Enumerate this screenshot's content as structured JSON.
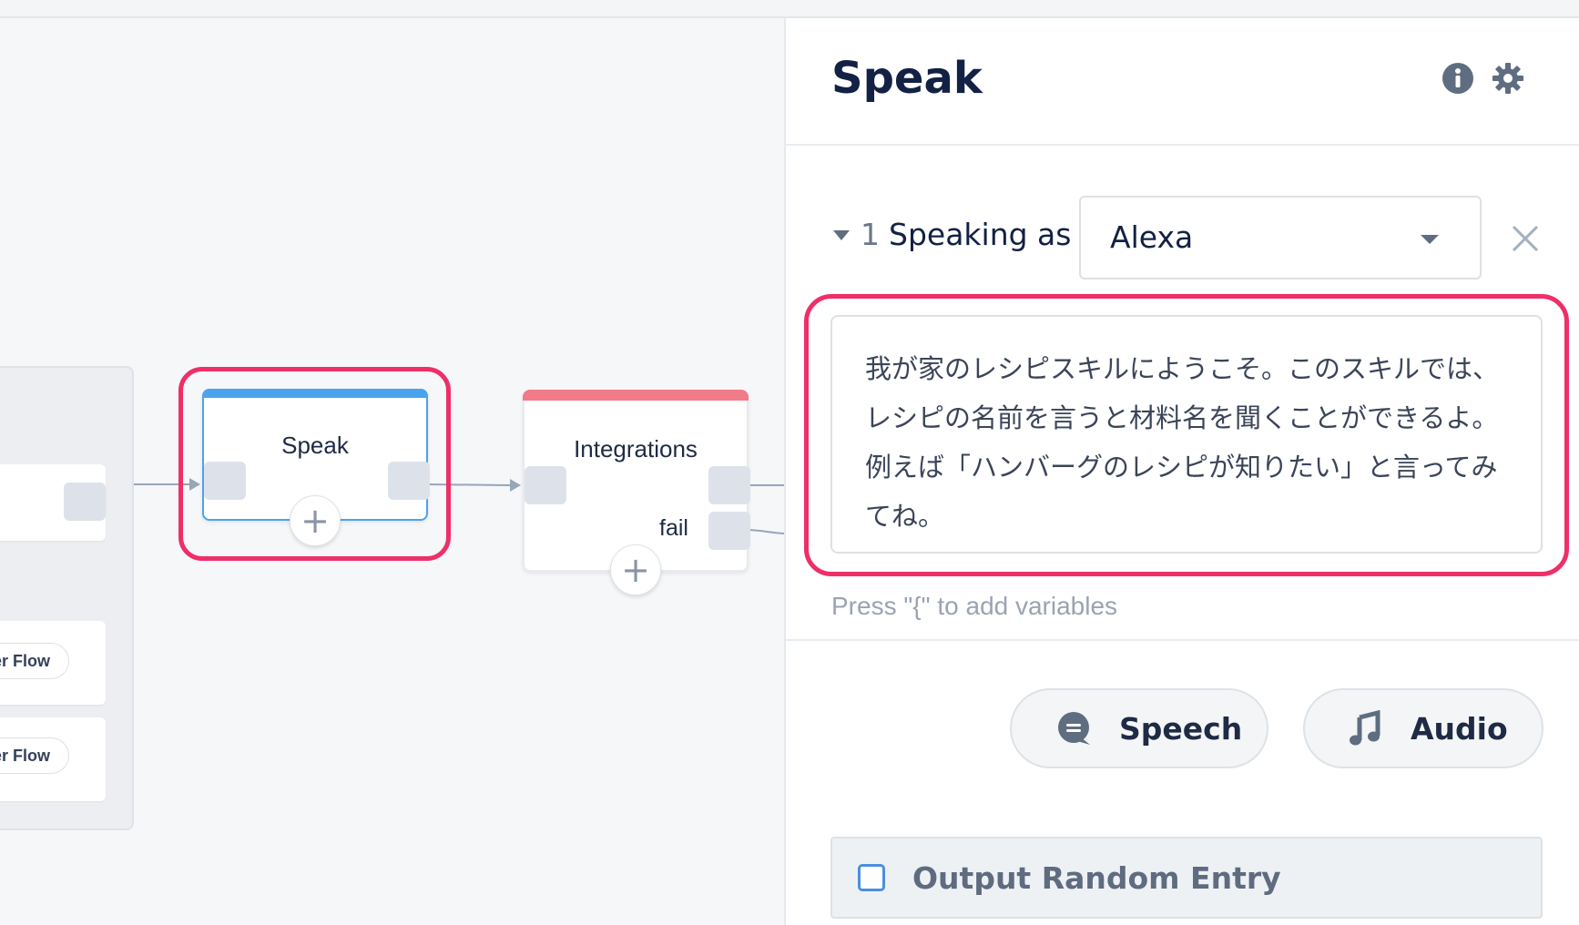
{
  "canvas": {
    "nodes": {
      "speak": {
        "title": "Speak",
        "accent": "#4aa3ef"
      },
      "integrations": {
        "title": "Integrations",
        "accent": "#f27b89",
        "fail_label": "fail"
      }
    },
    "group": {
      "pill_1": "ter Flow",
      "pill_2": "ter Flow"
    },
    "highlight_color": "#ee2f68"
  },
  "panel": {
    "title": "Speak",
    "info_icon": "info-icon",
    "settings_icon": "gear-icon",
    "speaking_as": {
      "index": "1",
      "label": "Speaking as",
      "voice": "Alexa"
    },
    "message_text": "我が家のレシピスキルにようこそ。このスキルでは、レシピの名前を言うと材料名を聞くことができるよ。例えば「ハンバーグのレシピが知りたい」と言ってみてね。",
    "hint": "Press \"{\" to add variables",
    "buttons": {
      "speech": "Speech",
      "audio": "Audio"
    },
    "random_entry_label": "Output Random Entry"
  }
}
